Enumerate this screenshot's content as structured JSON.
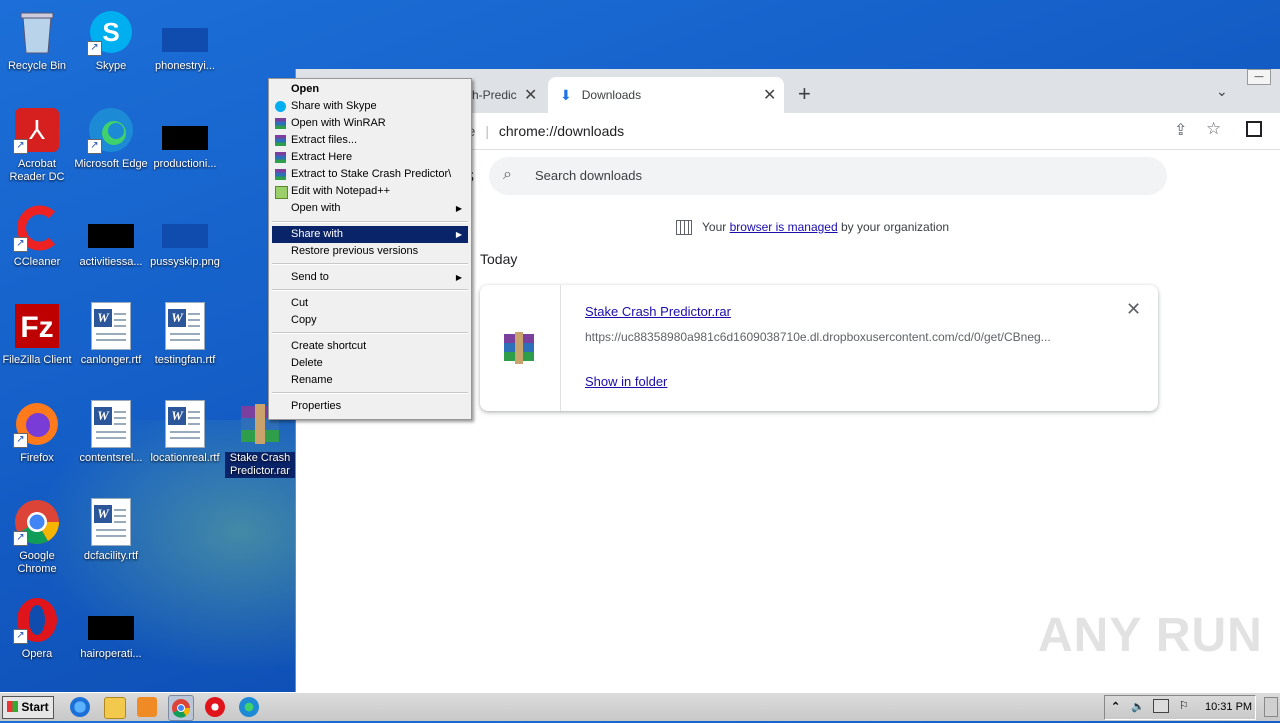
{
  "desktop": {
    "icons": [
      {
        "label": "Recycle Bin",
        "icon": "recycle-bin-icon"
      },
      {
        "label": "Skype",
        "icon": "skype-icon"
      },
      {
        "label": "phonestryi...",
        "icon": "image-file-icon"
      },
      {
        "label": "Acrobat Reader DC",
        "icon": "acrobat-icon"
      },
      {
        "label": "Microsoft Edge",
        "icon": "edge-icon"
      },
      {
        "label": "productioni...",
        "icon": "file-icon"
      },
      {
        "label": "CCleaner",
        "icon": "ccleaner-icon"
      },
      {
        "label": "activitiessa...",
        "icon": "file-icon"
      },
      {
        "label": "pussyskip.png",
        "icon": "image-file-icon"
      },
      {
        "label": "FileZilla Client",
        "icon": "filezilla-icon"
      },
      {
        "label": "canlonger.rtf",
        "icon": "word-doc-icon"
      },
      {
        "label": "testingfan.rtf",
        "icon": "word-doc-icon"
      },
      {
        "label": "Firefox",
        "icon": "firefox-icon"
      },
      {
        "label": "contentsrel...",
        "icon": "word-doc-icon"
      },
      {
        "label": "locationreal.rtf",
        "icon": "word-doc-icon"
      },
      {
        "label": "Stake Crash Predictor.rar",
        "icon": "winrar-icon"
      },
      {
        "label": "Google Chrome",
        "icon": "chrome-icon"
      },
      {
        "label": "dcfacility.rtf",
        "icon": "word-doc-icon"
      },
      {
        "label": "Opera",
        "icon": "opera-icon"
      },
      {
        "label": "hairoperati...",
        "icon": "file-icon"
      }
    ]
  },
  "context_menu": {
    "items": [
      {
        "label": "Open",
        "bold": true
      },
      {
        "label": "Share with Skype"
      },
      {
        "label": "Open with WinRAR"
      },
      {
        "label": "Extract files..."
      },
      {
        "label": "Extract Here"
      },
      {
        "label": "Extract to Stake Crash Predictor\\"
      },
      {
        "label": "Edit with Notepad++"
      },
      {
        "label": "Open with"
      },
      {
        "label": "Share with"
      },
      {
        "label": "Restore previous versions"
      },
      {
        "label": "Send to"
      },
      {
        "label": "Cut"
      },
      {
        "label": "Copy"
      },
      {
        "label": "Create shortcut"
      },
      {
        "label": "Delete"
      },
      {
        "label": "Rename"
      },
      {
        "label": "Properties"
      }
    ]
  },
  "browser": {
    "tab1_title": "sh-Predic",
    "tab2_title": "Downloads",
    "new_tab": "+",
    "omnibox_prefix": "me",
    "url": "chrome://downloads",
    "page_title_fragment": "s",
    "search_placeholder": "Search downloads",
    "managed_prefix": "Your ",
    "managed_link": "browser is managed",
    "managed_suffix": " by your organization",
    "section": "Today",
    "download": {
      "filename": "Stake Crash Predictor.rar",
      "url": "https://uc88358980a981c6d1609038710e.dl.dropboxusercontent.com/cd/0/get/CBneg...",
      "action": "Show in folder"
    }
  },
  "taskbar": {
    "start_label": "Start",
    "clock": "10:31 PM"
  },
  "watermark": "ANY RUN"
}
